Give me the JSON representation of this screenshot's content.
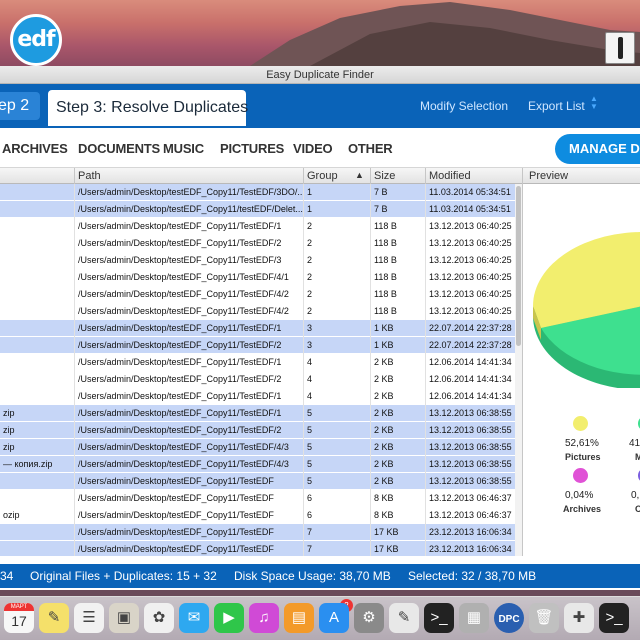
{
  "app": {
    "title": "Easy Duplicate Finder",
    "logo_text": "edf"
  },
  "steps": {
    "previous": "ep 2",
    "current_label": "Step 3:",
    "current_title": "Resolve Duplicates",
    "modify_selection": "Modify Selection",
    "export_list": "Export List"
  },
  "categories": [
    "ARCHIVES",
    "DOCUMENTS",
    "MUSIC",
    "PICTURES",
    "VIDEO",
    "OTHER"
  ],
  "manage_button": "MANAGE DU",
  "table": {
    "columns": {
      "path": "Path",
      "group": "Group",
      "size": "Size",
      "modified": "Modified"
    },
    "sort_indicator": "▲",
    "rows": [
      {
        "name": "",
        "path": "/Users/admin/Desktop/testEDF_Copy11/TestEDF/3DO/...",
        "group": "1",
        "size": "7 B",
        "modified": "11.03.2014 05:34:51",
        "selected": true
      },
      {
        "name": "",
        "path": "/Users/admin/Desktop/testEDF_Copy11/testEDF/Delet...",
        "group": "1",
        "size": "7 B",
        "modified": "11.03.2014 05:34:51",
        "selected": true
      },
      {
        "name": "",
        "path": "/Users/admin/Desktop/testEDF_Copy11/TestEDF/1",
        "group": "2",
        "size": "118 B",
        "modified": "13.12.2013 06:40:25",
        "selected": false
      },
      {
        "name": "",
        "path": "/Users/admin/Desktop/testEDF_Copy11/TestEDF/2",
        "group": "2",
        "size": "118 B",
        "modified": "13.12.2013 06:40:25",
        "selected": false
      },
      {
        "name": "",
        "path": "/Users/admin/Desktop/testEDF_Copy11/TestEDF/3",
        "group": "2",
        "size": "118 B",
        "modified": "13.12.2013 06:40:25",
        "selected": false
      },
      {
        "name": "",
        "path": "/Users/admin/Desktop/testEDF_Copy11/TestEDF/4/1",
        "group": "2",
        "size": "118 B",
        "modified": "13.12.2013 06:40:25",
        "selected": false
      },
      {
        "name": "",
        "path": "/Users/admin/Desktop/testEDF_Copy11/TestEDF/4/2",
        "group": "2",
        "size": "118 B",
        "modified": "13.12.2013 06:40:25",
        "selected": false
      },
      {
        "name": "",
        "path": "/Users/admin/Desktop/testEDF_Copy11/TestEDF/4/2",
        "group": "2",
        "size": "118 B",
        "modified": "13.12.2013 06:40:25",
        "selected": false
      },
      {
        "name": "",
        "path": "/Users/admin/Desktop/testEDF_Copy11/TestEDF/1",
        "group": "3",
        "size": "1 KB",
        "modified": "22.07.2014 22:37:28",
        "selected": true
      },
      {
        "name": "",
        "path": "/Users/admin/Desktop/testEDF_Copy11/TestEDF/2",
        "group": "3",
        "size": "1 KB",
        "modified": "22.07.2014 22:37:28",
        "selected": true
      },
      {
        "name": "",
        "path": "/Users/admin/Desktop/testEDF_Copy11/TestEDF/1",
        "group": "4",
        "size": "2 KB",
        "modified": "12.06.2014 14:41:34",
        "selected": false
      },
      {
        "name": "",
        "path": "/Users/admin/Desktop/testEDF_Copy11/TestEDF/2",
        "group": "4",
        "size": "2 KB",
        "modified": "12.06.2014 14:41:34",
        "selected": false
      },
      {
        "name": "",
        "path": "/Users/admin/Desktop/testEDF_Copy11/TestEDF/1",
        "group": "4",
        "size": "2 KB",
        "modified": "12.06.2014 14:41:34",
        "selected": false
      },
      {
        "name": "zip",
        "path": "/Users/admin/Desktop/testEDF_Copy11/TestEDF/1",
        "group": "5",
        "size": "2 KB",
        "modified": "13.12.2013 06:38:55",
        "selected": true
      },
      {
        "name": "zip",
        "path": "/Users/admin/Desktop/testEDF_Copy11/TestEDF/2",
        "group": "5",
        "size": "2 KB",
        "modified": "13.12.2013 06:38:55",
        "selected": true
      },
      {
        "name": "zip",
        "path": "/Users/admin/Desktop/testEDF_Copy11/TestEDF/4/3",
        "group": "5",
        "size": "2 KB",
        "modified": "13.12.2013 06:38:55",
        "selected": true
      },
      {
        "name": "— копия.zip",
        "path": "/Users/admin/Desktop/testEDF_Copy11/TestEDF/4/3",
        "group": "5",
        "size": "2 KB",
        "modified": "13.12.2013 06:38:55",
        "selected": true
      },
      {
        "name": "",
        "path": "/Users/admin/Desktop/testEDF_Copy11/TestEDF",
        "group": "5",
        "size": "2 KB",
        "modified": "13.12.2013 06:38:55",
        "selected": true
      },
      {
        "name": "",
        "path": "/Users/admin/Desktop/testEDF_Copy11/TestEDF",
        "group": "6",
        "size": "8 KB",
        "modified": "13.12.2013 06:46:37",
        "selected": false
      },
      {
        "name": "ozip",
        "path": "/Users/admin/Desktop/testEDF_Copy11/TestEDF",
        "group": "6",
        "size": "8 KB",
        "modified": "13.12.2013 06:46:37",
        "selected": false
      },
      {
        "name": "",
        "path": "/Users/admin/Desktop/testEDF_Copy11/TestEDF",
        "group": "7",
        "size": "17 KB",
        "modified": "23.12.2013 16:06:34",
        "selected": true
      },
      {
        "name": "",
        "path": "/Users/admin/Desktop/testEDF_Copy11/TestEDF",
        "group": "7",
        "size": "17 KB",
        "modified": "23.12.2013 16:06:34",
        "selected": true
      }
    ]
  },
  "preview": {
    "title": "Preview",
    "slices": [
      {
        "label": "Pictures",
        "pct": "52,61%",
        "color": "#f2ee6e"
      },
      {
        "label": "M",
        "pct": "41",
        "color": "#3ee08f"
      },
      {
        "label": "Archives",
        "pct": "0,04%",
        "color": "#e052d6"
      },
      {
        "label": "O",
        "pct": "0,",
        "color": "#7a5ee0"
      }
    ]
  },
  "status": {
    "left": "34",
    "original": "Original Files + Duplicates: 15 + 32",
    "disk": "Disk Space Usage: 38,70 MB",
    "selected": "Selected: 32 / 38,70 MB"
  },
  "dock": {
    "calendar_month": "МАРТ",
    "calendar_day": "17",
    "badge": "2",
    "dpc_label": "DPC",
    "icons": [
      "calendar-icon",
      "notes-icon",
      "reminders-icon",
      "preview-icon",
      "photos-icon",
      "messages-icon",
      "facetime-icon",
      "itunes-icon",
      "ibooks-icon",
      "appstore-icon",
      "system-preferences-icon",
      "script-icon",
      "terminal-icon",
      "photo-viewer-icon",
      "dpc-icon",
      "trash-icon",
      "pdf-icon",
      "terminal2-icon"
    ]
  }
}
